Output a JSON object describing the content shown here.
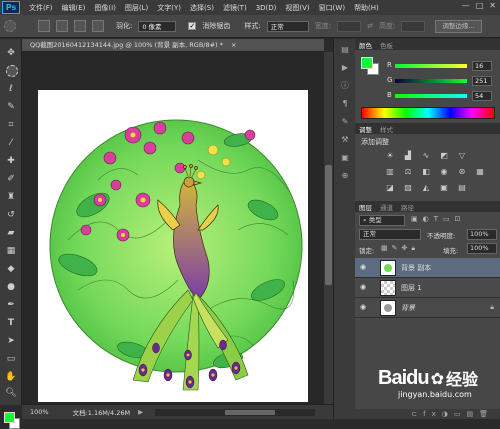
{
  "menubar": {
    "logo": "Ps",
    "items": [
      "文件(F)",
      "编辑(E)",
      "图像(I)",
      "图层(L)",
      "文字(Y)",
      "选择(S)",
      "滤镜(T)",
      "3D(D)",
      "视图(V)",
      "窗口(W)",
      "帮助(H)"
    ],
    "window_controls": [
      "—",
      "□",
      "✕"
    ]
  },
  "options": {
    "feather_label": "羽化:",
    "feather_value": "0 像素",
    "antialias_label": "消除锯齿",
    "style_label": "样式:",
    "style_value": "正常",
    "width_label": "宽度:",
    "height_label": "高度:",
    "refine_edge_label": "调整边缘..."
  },
  "document": {
    "tab_title": "QQ截图20160412134144.jpg @ 100% (背景 副本, RGB/8#) *",
    "tab_close": "×"
  },
  "status": {
    "zoom": "100%",
    "doc_info": "文档:1.16M/4.26M"
  },
  "color_panel": {
    "tabs": [
      "颜色",
      "色板"
    ],
    "channels": [
      {
        "label": "R",
        "value": "16"
      },
      {
        "label": "G",
        "value": "251"
      },
      {
        "label": "B",
        "value": "54"
      }
    ],
    "foreground_color": "#10fb36",
    "background_color": "#ffffff"
  },
  "adjust_panel": {
    "tabs": [
      "调整",
      "样式"
    ],
    "title": "添加调整"
  },
  "layers_panel": {
    "tabs": [
      "图层",
      "通道",
      "路径"
    ],
    "filter_label": "类型",
    "blend_mode": "正常",
    "opacity_label": "不透明度:",
    "opacity_value": "100%",
    "lock_label": "锁定:",
    "fill_label": "填充:",
    "fill_value": "100%",
    "layers": [
      {
        "name": "背景 副本",
        "selected": true
      },
      {
        "name": "图层 1",
        "selected": false
      },
      {
        "name": "背景",
        "selected": false,
        "locked": true
      }
    ]
  },
  "watermark": {
    "brand": "Baidu",
    "suffix": "经验",
    "url": "jingyan.baidu.com"
  }
}
